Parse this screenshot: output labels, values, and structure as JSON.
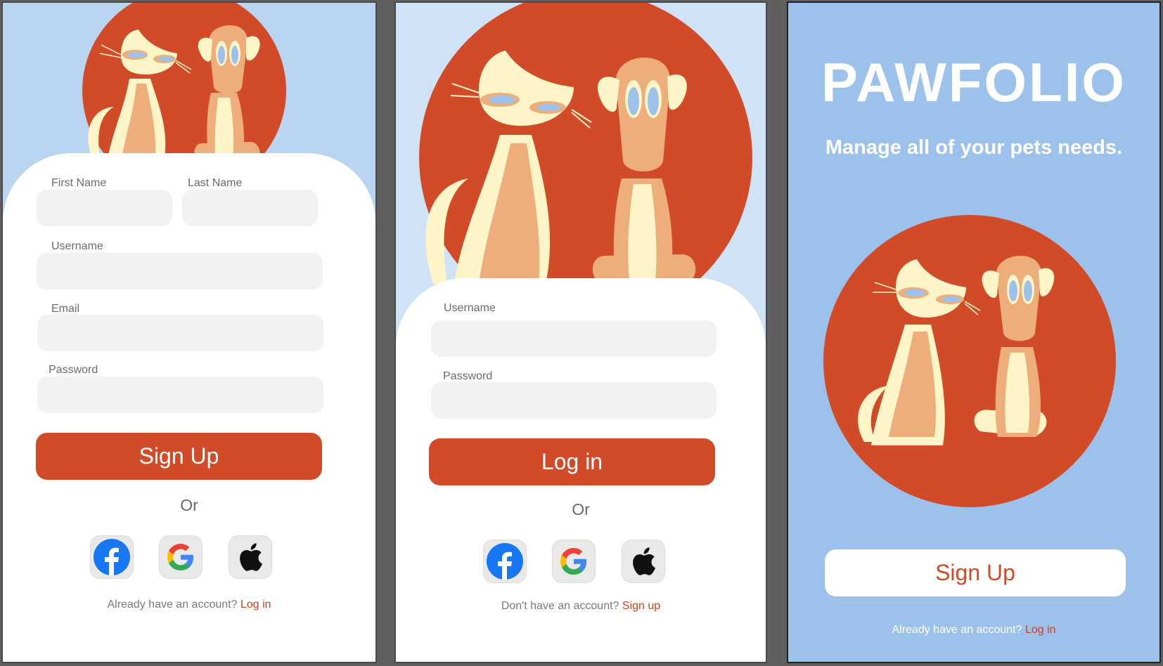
{
  "colors": {
    "accent": "#d24b28",
    "link": "#d2401e",
    "panel1": "#bad5f2",
    "panel2": "#d0e2f6",
    "panel3": "#9cc2eb",
    "field": "#f1f2f2"
  },
  "signup": {
    "first_name_label": "First Name",
    "last_name_label": "Last Name",
    "username_label": "Username",
    "email_label": "Email",
    "password_label": "Password",
    "submit_label": "Sign Up",
    "or_label": "Or",
    "footer_text": "Already have an account?",
    "footer_link": "Log in",
    "social_icons": [
      "facebook-icon",
      "google-icon",
      "apple-icon"
    ]
  },
  "login": {
    "username_label": "Username",
    "password_label": "Password",
    "submit_label": "Log in",
    "or_label": "Or",
    "footer_text": "Don't have an account?",
    "footer_link": "Sign up"
  },
  "welcome": {
    "title": "PAWFOLIO",
    "tagline": "Manage all of your pets needs.",
    "signup_label": "Sign Up",
    "footer_text": "Already have an account?",
    "footer_link": "Log in"
  }
}
